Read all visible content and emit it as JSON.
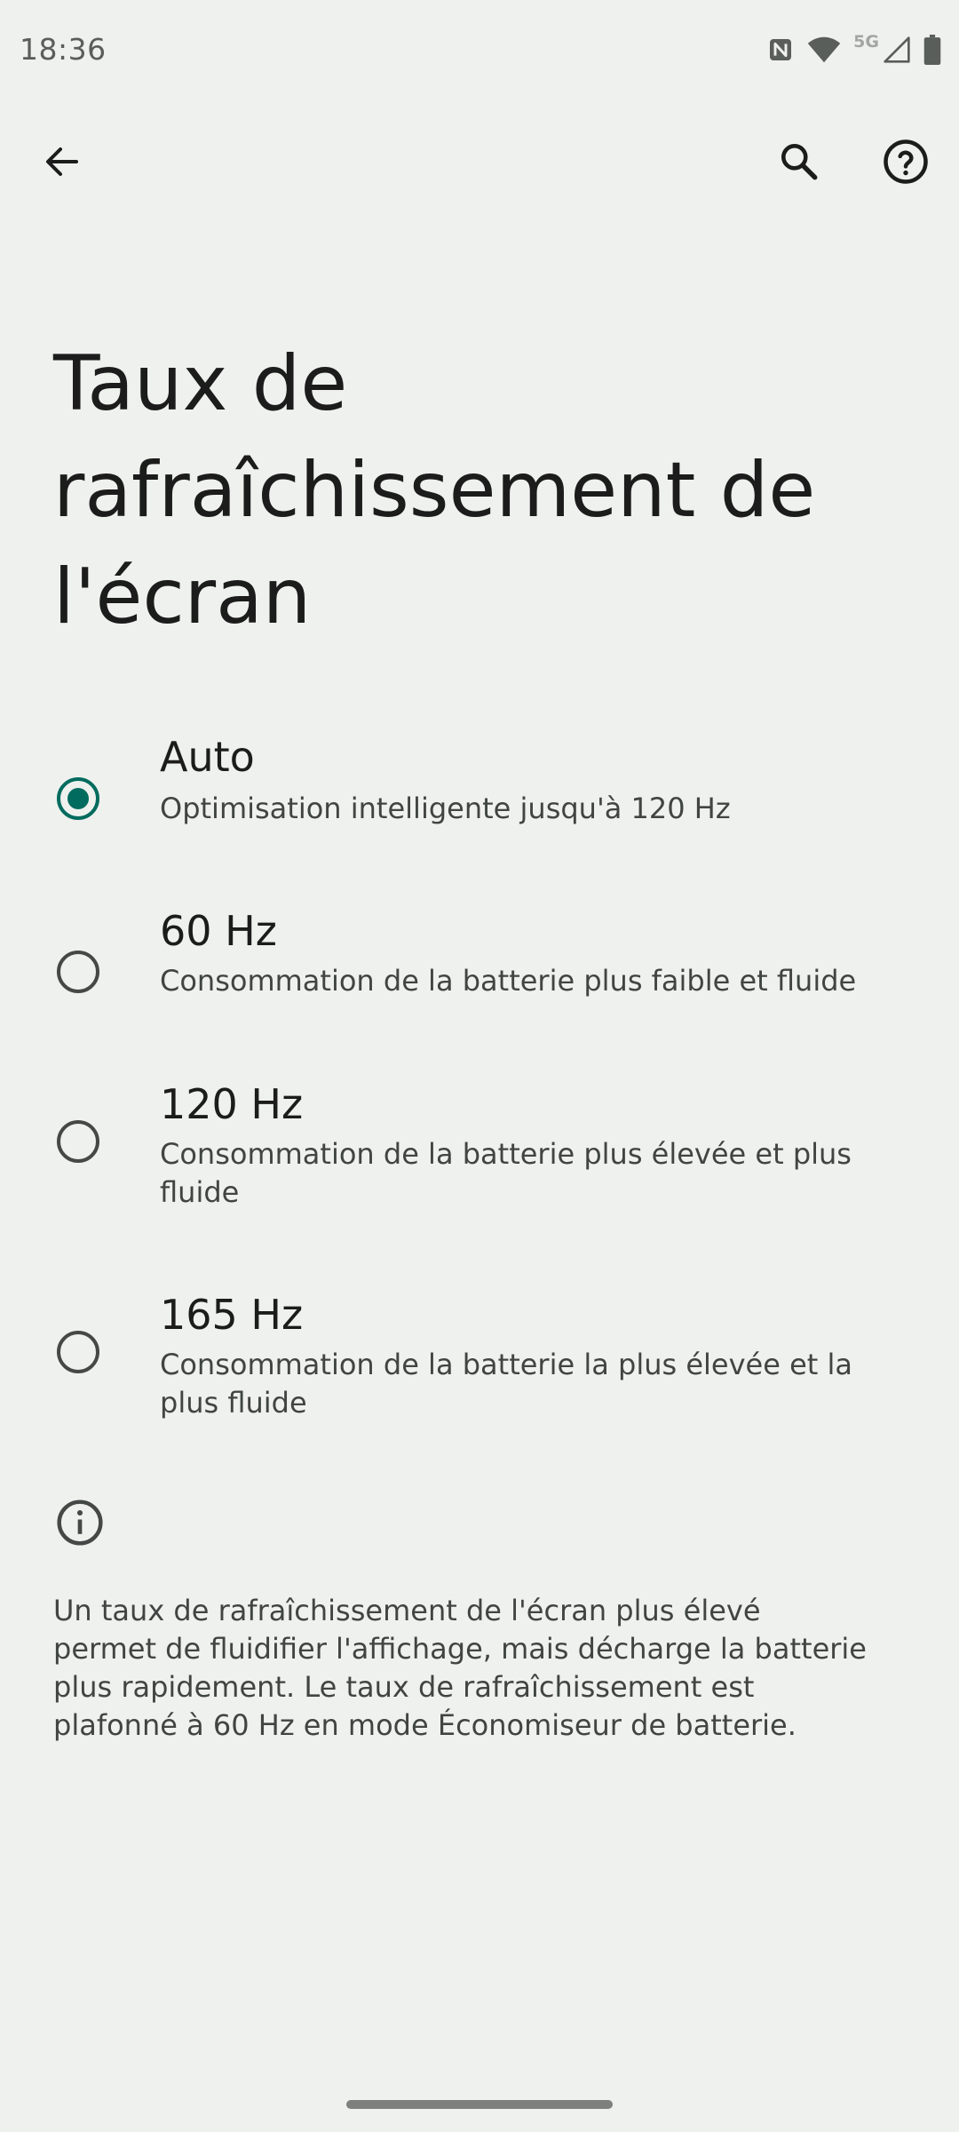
{
  "status_bar": {
    "time": "18:36",
    "network_label": "5G",
    "icons": [
      "nfc-icon",
      "wifi-icon",
      "signal-icon",
      "battery-icon"
    ]
  },
  "toolbar": {
    "back_icon": "arrow-back-icon",
    "search_icon": "search-icon",
    "help_icon": "help-circle-icon"
  },
  "page": {
    "title": "Taux de rafraîchissement de l'écran"
  },
  "options": [
    {
      "title": "Auto",
      "summary": "Optimisation intelligente jusqu'à 120 Hz",
      "selected": true
    },
    {
      "title": "60 Hz",
      "summary": "Consommation de la batterie plus faible et fluide",
      "selected": false
    },
    {
      "title": "120 Hz",
      "summary": "Consommation de la batterie plus élevée et plus fluide",
      "selected": false
    },
    {
      "title": "165 Hz",
      "summary": "Consommation de la batterie la plus élevée et la plus fluide",
      "selected": false
    }
  ],
  "footer": {
    "icon": "info-icon",
    "text": "Un taux de rafraîchissement de l'écran plus élevé permet de fluidifier l'affichage, mais décharge la batterie plus rapidement. Le taux de rafraîchissement est plafonné à 60 Hz en mode Économiseur de batterie."
  },
  "colors": {
    "background": "#eff1ee",
    "accent": "#006b5e",
    "text_primary": "#1b1c1b",
    "text_secondary": "#404543"
  }
}
